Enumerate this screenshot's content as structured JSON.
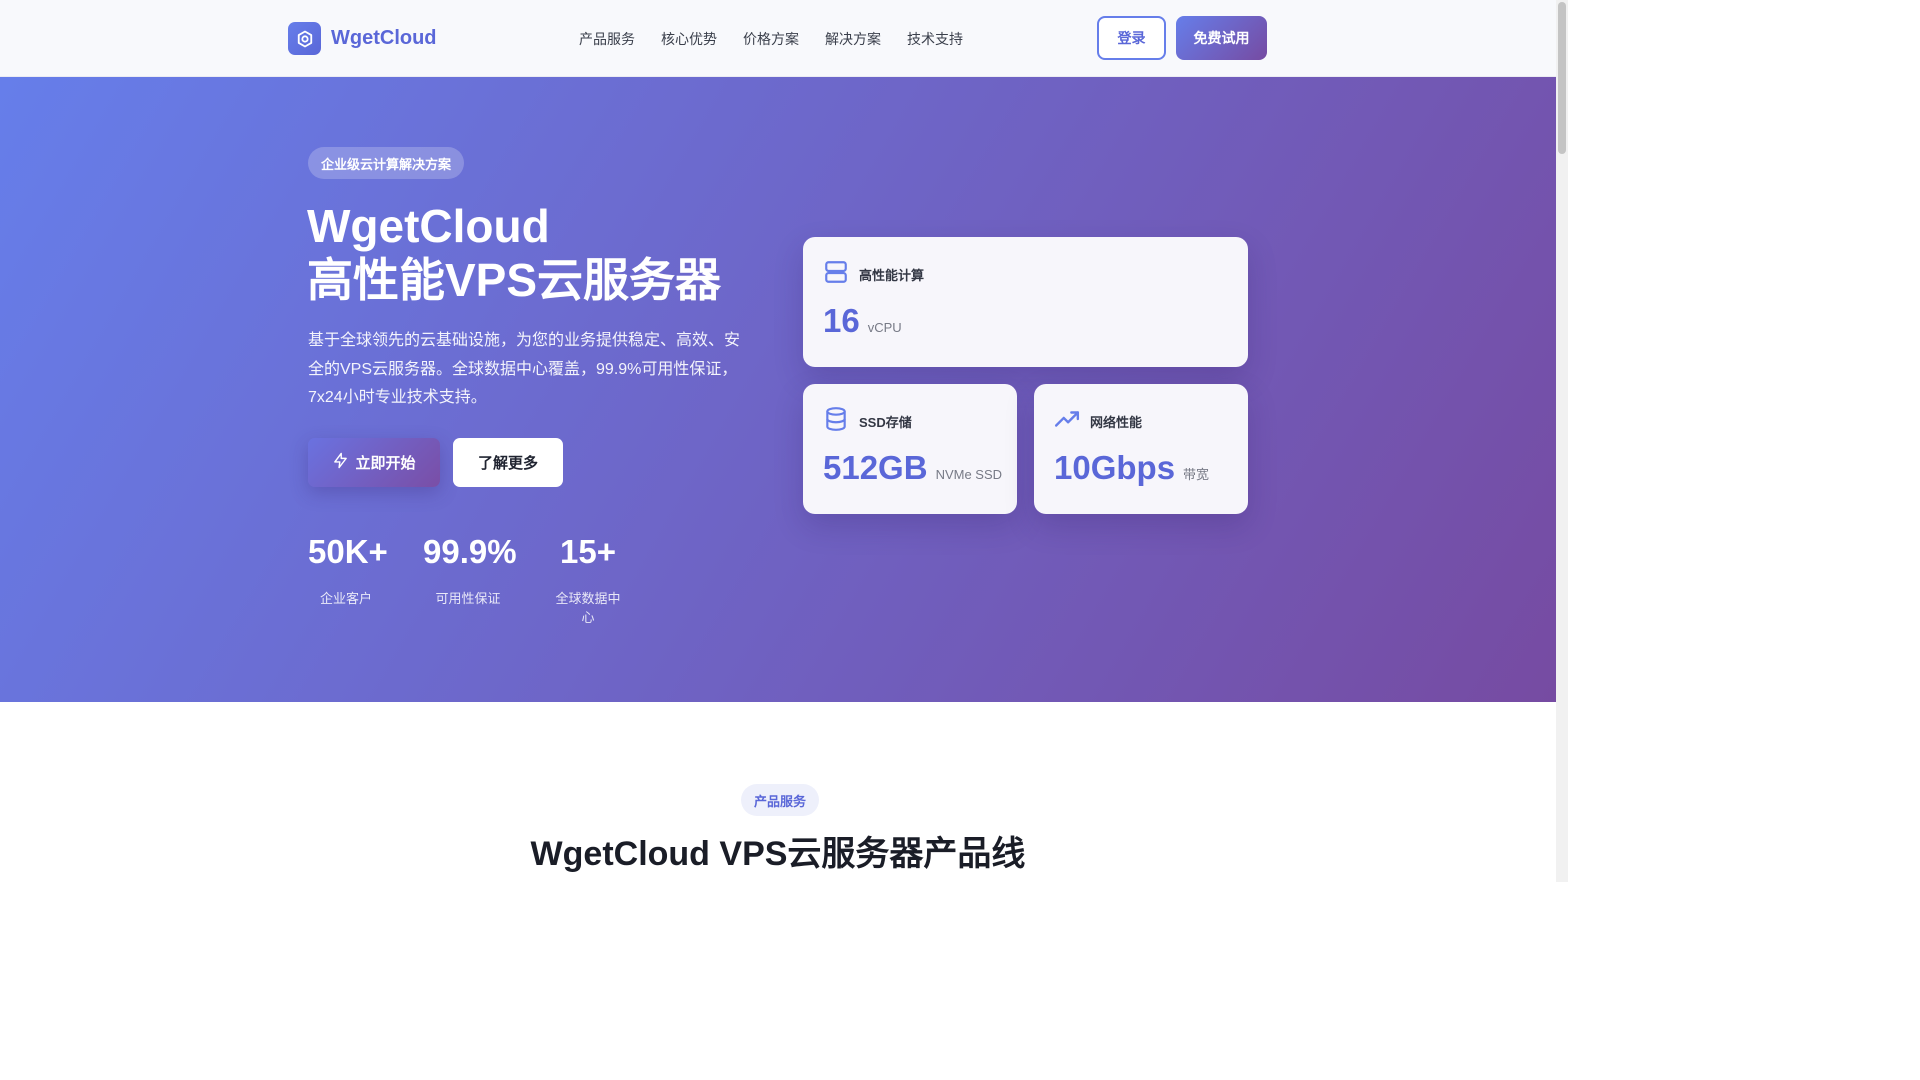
{
  "header": {
    "logo_text": "WgetCloud",
    "nav": [
      {
        "label": "产品服务"
      },
      {
        "label": "核心优势"
      },
      {
        "label": "价格方案"
      },
      {
        "label": "解决方案"
      },
      {
        "label": "技术支持"
      }
    ],
    "login_label": "登录",
    "trial_label": "免费试用"
  },
  "hero": {
    "badge": "企业级云计算解决方案",
    "title_line1": "WgetCloud",
    "title_line2": "高性能VPS云服务器",
    "description": "基于全球领先的云基础设施，为您的业务提供稳定、高效、安全的VPS云服务器。全球数据中心覆盖，99.9%可用性保证，7x24小时专业技术支持。",
    "start_label": "立即开始",
    "more_label": "了解更多",
    "stats": [
      {
        "value": "50K+",
        "label": "企业客户"
      },
      {
        "value": "99.9%",
        "label": "可用性保证"
      },
      {
        "value": "15+",
        "label": "全球数据中心"
      }
    ],
    "cards": [
      {
        "title": "高性能计算",
        "value": "16",
        "unit": "vCPU",
        "icon": "server-icon"
      },
      {
        "title": "SSD存储",
        "value": "512GB",
        "unit": "NVMe SSD",
        "icon": "database-icon"
      },
      {
        "title": "网络性能",
        "value": "10Gbps",
        "unit": "带宽",
        "icon": "trending-up-icon"
      }
    ]
  },
  "products": {
    "tag": "产品服务",
    "title": "WgetCloud VPS云服务器产品线"
  },
  "colors": {
    "accent": "#667eea",
    "accent_dark": "#764ba2",
    "brand_text": "#5a67d8"
  }
}
